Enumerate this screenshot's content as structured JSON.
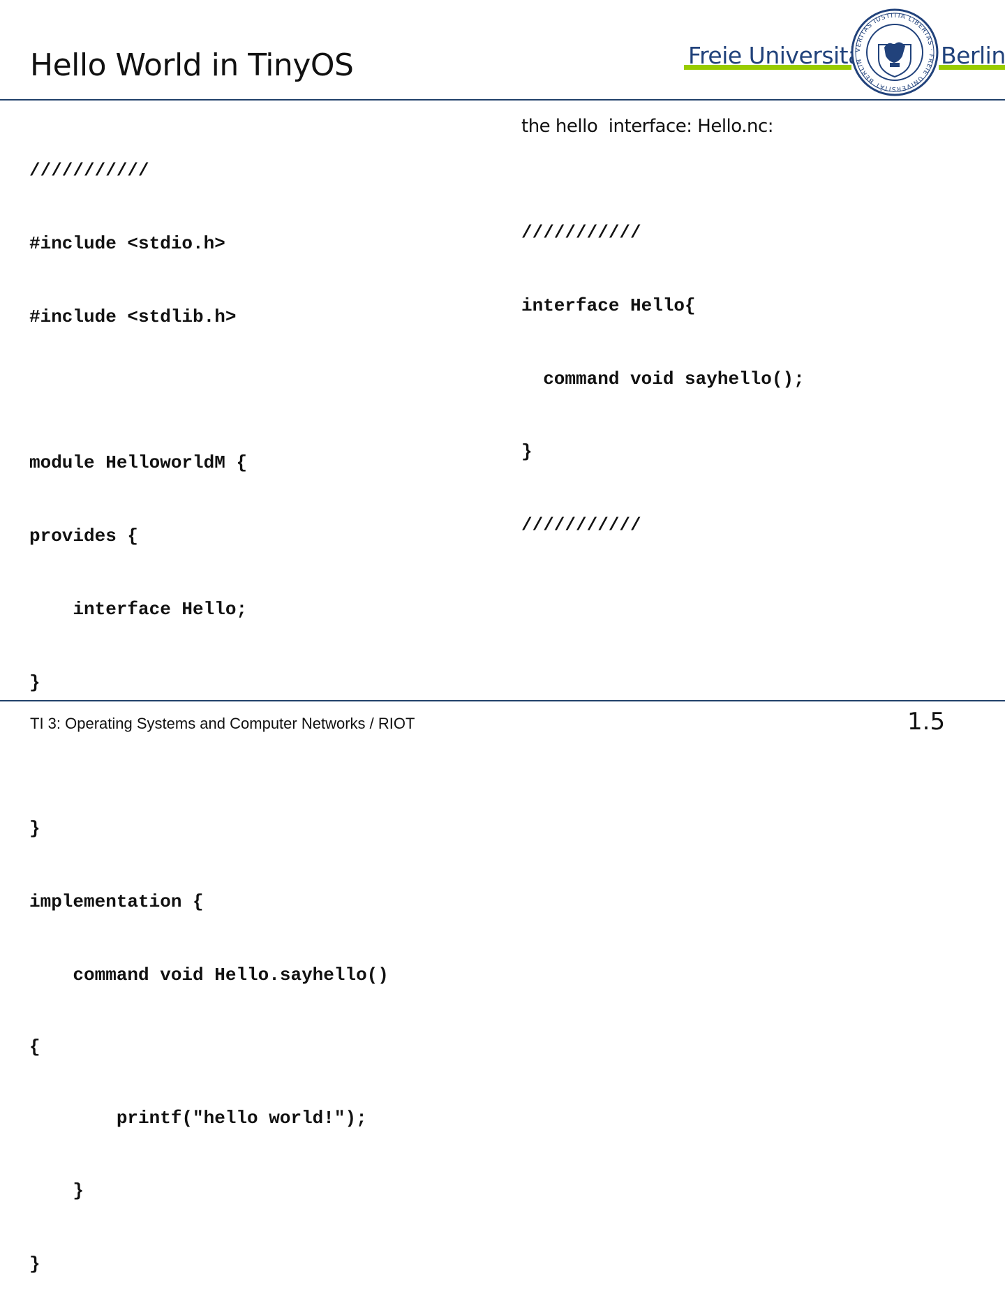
{
  "slide": {
    "title": "Hello World in TinyOS",
    "logo": {
      "left_text": "Freie Universität",
      "right_text": "Berlin",
      "seal_text": "VERITAS IUSTITIA LIBERTAS · FREIE UNIVERSITÄT BERLIN",
      "brand_color": "#21427b",
      "accent_color": "#99cc00"
    },
    "left_code": [
      "///////////",
      "#include <stdio.h>",
      "#include <stdlib.h>",
      "",
      "module HelloworldM {",
      "provides {",
      "    interface Hello;",
      "}",
      "",
      "}",
      "implementation {",
      "    command void Hello.sayhello()",
      "{",
      "        printf(\"hello world!\");",
      "    }",
      "}"
    ],
    "right_caption": "the hello  interface: Hello.nc:",
    "right_code": [
      "///////////",
      "interface Hello{",
      "  command void sayhello();",
      "}",
      "///////////"
    ],
    "footer": "TI 3: Operating Systems and Computer Networks / RIOT",
    "page_number": "1.5",
    "rule_color": "#20406a"
  }
}
